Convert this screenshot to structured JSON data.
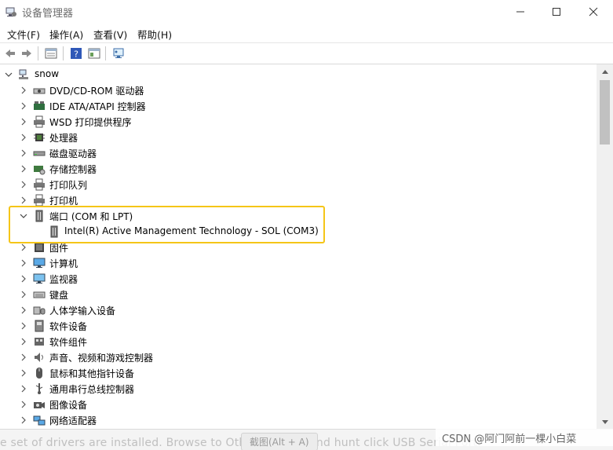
{
  "window": {
    "title": "设备管理器",
    "minimize_symbol": "—",
    "maximize_symbol": "☐",
    "close_symbol": "✕"
  },
  "menu": {
    "file": "文件(F)",
    "action": "操作(A)",
    "view": "查看(V)",
    "help": "帮助(H)"
  },
  "toolbar": {
    "icons": [
      "back-arrow-icon",
      "forward-arrow-icon",
      "properties-icon",
      "help-icon",
      "view-icon",
      "monitor-scan-icon"
    ]
  },
  "tree": {
    "root": "snow",
    "items": [
      {
        "label": "DVD/CD-ROM 驱动器",
        "icon": "optical-drive-icon",
        "expanded": false
      },
      {
        "label": "IDE ATA/ATAPI 控制器",
        "icon": "ide-controller-icon",
        "expanded": false
      },
      {
        "label": "WSD 打印提供程序",
        "icon": "printer-icon",
        "expanded": false
      },
      {
        "label": "处理器",
        "icon": "processor-icon",
        "expanded": false
      },
      {
        "label": "磁盘驱动器",
        "icon": "disk-drive-icon",
        "expanded": false
      },
      {
        "label": "存储控制器",
        "icon": "storage-controller-icon",
        "expanded": false
      },
      {
        "label": "打印队列",
        "icon": "printer-icon",
        "expanded": false
      },
      {
        "label": "打印机",
        "icon": "printer-icon",
        "expanded": false
      },
      {
        "label": "端口 (COM 和 LPT)",
        "icon": "port-icon",
        "expanded": true
      },
      {
        "label": "Intel(R) Active Management Technology - SOL (COM3)",
        "icon": "port-icon",
        "child": true
      },
      {
        "label": "固件",
        "icon": "firmware-icon",
        "expanded": false
      },
      {
        "label": "计算机",
        "icon": "computer-icon",
        "expanded": false
      },
      {
        "label": "监视器",
        "icon": "monitor-icon",
        "expanded": false
      },
      {
        "label": "键盘",
        "icon": "keyboard-icon",
        "expanded": false
      },
      {
        "label": "人体学输入设备",
        "icon": "hid-icon",
        "expanded": false
      },
      {
        "label": "软件设备",
        "icon": "software-device-icon",
        "expanded": false
      },
      {
        "label": "软件组件",
        "icon": "software-component-icon",
        "expanded": false
      },
      {
        "label": "声音、视频和游戏控制器",
        "icon": "sound-icon",
        "expanded": false
      },
      {
        "label": "鼠标和其他指针设备",
        "icon": "mouse-icon",
        "expanded": false
      },
      {
        "label": "通用串行总线控制器",
        "icon": "usb-icon",
        "expanded": false
      },
      {
        "label": "图像设备",
        "icon": "camera-icon",
        "expanded": false
      },
      {
        "label": "网络适配器",
        "icon": "network-icon",
        "expanded": false
      }
    ]
  },
  "bottom": {
    "ghost_text": "e set of drivers are installed. Browse to Other Devices and hunt click USB Serial Port.",
    "screenshot_hint": "截图(Alt + A)"
  },
  "watermark": "CSDN @阿门阿前一棵小白菜",
  "colors": {
    "highlight_border": "#f5c518",
    "scrollbar_track": "#f0f0f0",
    "scrollbar_thumb": "#c1c1c1"
  }
}
